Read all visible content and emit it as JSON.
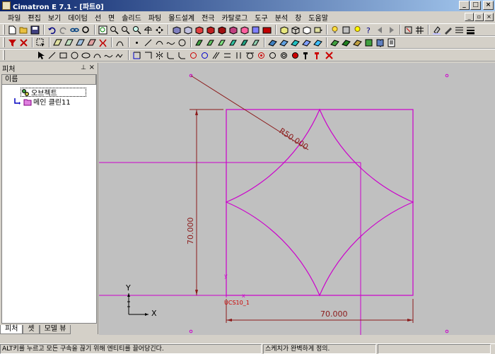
{
  "window": {
    "title": "Cimatron E 7.1 - [파트0]"
  },
  "menu": [
    "파일",
    "편집",
    "보기",
    "데이텀",
    "선",
    "면",
    "솔리드",
    "파팅",
    "몰드설계",
    "전극",
    "카탈로그",
    "도구",
    "분석",
    "창",
    "도움말"
  ],
  "panel": {
    "title": "피처",
    "column_header": "이름",
    "tree": [
      {
        "label": "오브젝트",
        "icon": "object-icon"
      },
      {
        "label": "메인 클린11",
        "icon": "sketch-icon"
      }
    ],
    "tabs": [
      "피처",
      "셋",
      "모델 뷰"
    ]
  },
  "canvas": {
    "radius_label": "R50.000",
    "dim_vertical": "70.000",
    "dim_horizontal": "70.000",
    "ucs_label": "UCS10_1",
    "axis_y": "Y",
    "axis_x": "X",
    "colors": {
      "sketch": "#cc00cc",
      "dimension": "#8b1a1a",
      "background": "#c0c0c0"
    }
  },
  "status": {
    "left": "ALT키를 누르고 모든 구속을 끊기 위해 엔티티를 끌어당긴다.",
    "right": "스케치가 완벽하게 정의."
  }
}
